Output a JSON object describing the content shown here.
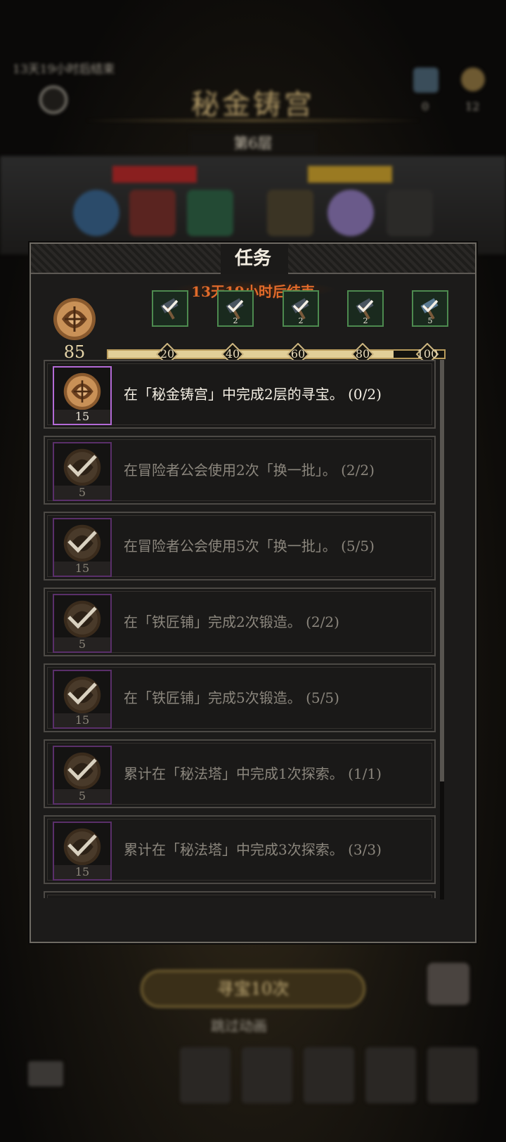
{
  "background": {
    "event_timer": "13天19小时后结束",
    "title": "秘金铸宫",
    "floor": "第6层",
    "resource_a": "0",
    "resource_b": "12",
    "cta": "寻宝10次",
    "skip": "跳过动画"
  },
  "modal": {
    "title": "任务",
    "timer": "13天19小时后结束",
    "points": "85",
    "milestones": [
      "20",
      "40",
      "60",
      "80",
      "100"
    ],
    "progress_fraction": 0.85,
    "rewards": [
      {
        "count": "",
        "claimed": true
      },
      {
        "count": "2",
        "claimed": true
      },
      {
        "count": "2",
        "claimed": true
      },
      {
        "count": "2",
        "claimed": true
      },
      {
        "count": "5",
        "claimed": true
      }
    ],
    "tasks": [
      {
        "text": "在「秘金铸宫」中完成2层的寻宝。 (0/2)",
        "reward": "15",
        "done": false
      },
      {
        "text": "在冒险者公会使用2次「换一批」。 (2/2)",
        "reward": "5",
        "done": true
      },
      {
        "text": "在冒险者公会使用5次「换一批」。 (5/5)",
        "reward": "15",
        "done": true
      },
      {
        "text": "在「铁匠铺」完成2次锻造。 (2/2)",
        "reward": "5",
        "done": true
      },
      {
        "text": "在「铁匠铺」完成5次锻造。 (5/5)",
        "reward": "15",
        "done": true
      },
      {
        "text": "累计在「秘法塔」中完成1次探索。 (1/1)",
        "reward": "5",
        "done": true
      },
      {
        "text": "累计在「秘法塔」中完成3次探索。 (3/3)",
        "reward": "15",
        "done": true
      }
    ]
  },
  "colors": {
    "accent_gold": "#e2cf98",
    "timer_orange": "#e06a2a",
    "reward_green": "#4d8a4f",
    "task_purple": "#b36ad6"
  }
}
